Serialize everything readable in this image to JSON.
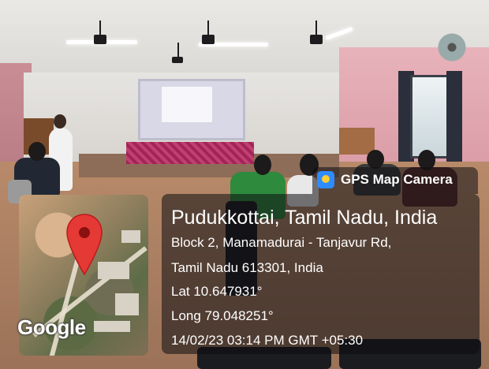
{
  "badge": {
    "text": "GPS Map Camera",
    "icon": "gps-map-camera-app-icon"
  },
  "location": {
    "title": "Pudukkottai, Tamil Nadu, India",
    "address_line1": "Block 2, Manamadurai - Tanjavur Rd,",
    "address_line2": "Tamil Nadu 613301, India",
    "lat": "Lat 10.647931°",
    "long": "Long 79.048251°",
    "datetime": "14/02/23 03:14 PM GMT +05:30"
  },
  "map": {
    "logo": "Google",
    "pin_icon": "location-pin-icon",
    "pin_color": "#e53935"
  },
  "colors": {
    "panel_bg": "rgba(12,12,16,0.55)",
    "text": "#ffffff"
  }
}
